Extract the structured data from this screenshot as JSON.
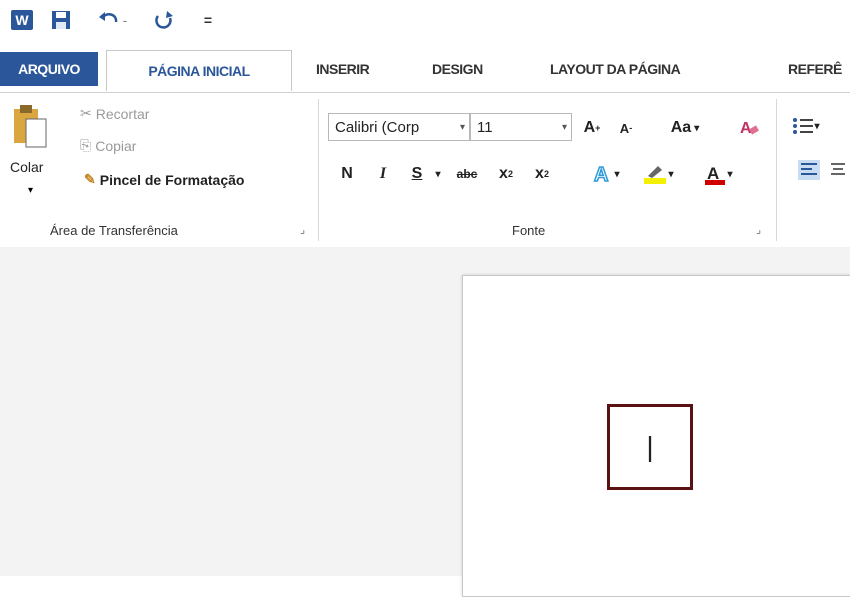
{
  "quick_access": {
    "icons": [
      "word-app-icon",
      "save-icon",
      "undo-icon",
      "redo-icon",
      "customize-icon"
    ],
    "word_letter": "W",
    "undo_dropdown": "-",
    "customize_glyph": "="
  },
  "tabs": [
    {
      "label": "ARQUIVO"
    },
    {
      "label": "PÁGINA INICIAL"
    },
    {
      "label": "INSERIR"
    },
    {
      "label": "DESIGN"
    },
    {
      "label": "LAYOUT DA PÁGINA"
    },
    {
      "label": "REFERÊ"
    }
  ],
  "clipboard": {
    "paste_label": "Colar",
    "cut_label": "Recortar",
    "copy_label": "Copiar",
    "format_painter_label": "Pincel de Formatação",
    "group_label": "Área de Transferência"
  },
  "font": {
    "font_name": "Calibri (Corp",
    "font_size": "11",
    "grow": "A",
    "shrink": "A",
    "change_case": "Aa",
    "bold": "N",
    "italic": "I",
    "underline": "S",
    "strikethrough": "abc",
    "subscript": "x",
    "superscript": "x",
    "group_label": "Fonte"
  },
  "colors": {
    "accent": "#2b579a",
    "highlight": "#f4f000",
    "font_color": "#d00000",
    "box_border": "#5a1111"
  },
  "document": {
    "cursor_text": "|"
  }
}
